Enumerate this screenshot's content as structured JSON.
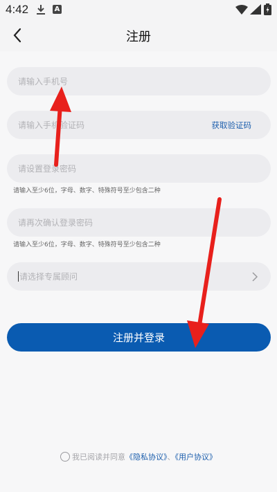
{
  "status_bar": {
    "time": "4:42",
    "icons": [
      "download-icon",
      "a-icon",
      "wifi-icon",
      "signal-icon",
      "battery-icon"
    ],
    "a_icon_letter": "A"
  },
  "header": {
    "title": "注册",
    "back_icon": "chevron-left-icon"
  },
  "form": {
    "phone_placeholder": "请输入手机号",
    "code_placeholder": "请输入手机验证码",
    "get_code_label": "获取验证码",
    "password_placeholder": "请设置登录密码",
    "password_hint": "请输入至少6位，字母、数字、特殊符号至少包含二种",
    "confirm_placeholder": "请再次确认登录密码",
    "confirm_hint": "请输入至少6位，字母、数字、特殊符号至少包含二种",
    "advisor_placeholder": "请选择专属顾问",
    "submit_label": "注册并登录"
  },
  "agreement": {
    "prefix": "我已阅读并同意",
    "privacy_link": "《隐私协议》",
    "separator": "、",
    "user_link": "《用户协议》"
  },
  "annotations": {
    "arrow_color": "#e8201c"
  },
  "colors": {
    "accent": "#0a5bb1",
    "link": "#1d5fad"
  }
}
